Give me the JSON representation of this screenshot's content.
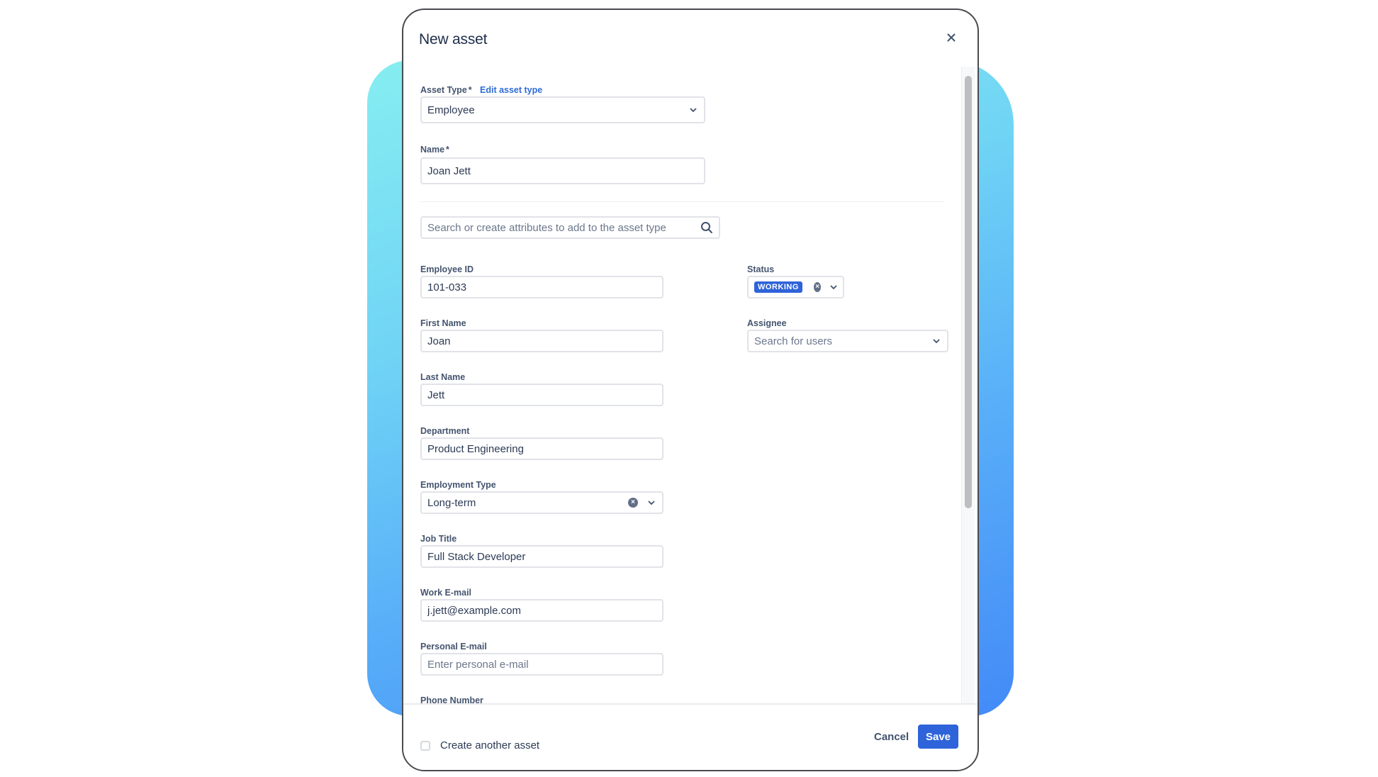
{
  "modal": {
    "title": "New asset",
    "close_icon": "close-icon"
  },
  "asset_type": {
    "label": "Asset Type",
    "required_mark": "*",
    "edit_link": "Edit asset type",
    "value": "Employee"
  },
  "name": {
    "label": "Name",
    "required_mark": "*",
    "value": "Joan Jett"
  },
  "attribute_search": {
    "placeholder": "Search or create attributes to add to the asset type",
    "icon": "search-icon"
  },
  "fields": {
    "employee_id": {
      "label": "Employee ID",
      "value": "101-033"
    },
    "first_name": {
      "label": "First Name",
      "value": "Joan"
    },
    "last_name": {
      "label": "Last Name",
      "value": "Jett"
    },
    "department": {
      "label": "Department",
      "value": "Product Engineering"
    },
    "employment_type": {
      "label": "Employment Type",
      "value": "Long-term"
    },
    "job_title": {
      "label": "Job Title",
      "value": "Full Stack Developer"
    },
    "work_email": {
      "label": "Work E-mail",
      "value": "j.jett@example.com"
    },
    "personal_email": {
      "label": "Personal E-mail",
      "value": "",
      "placeholder": "Enter personal e-mail"
    },
    "phone_number": {
      "label": "Phone Number",
      "value": ""
    },
    "status": {
      "label": "Status",
      "value": "WORKING",
      "badge_color": "#2E63D9"
    },
    "assignee": {
      "label": "Assignee",
      "value": "",
      "placeholder": "Search for users"
    }
  },
  "footer": {
    "create_another_label": "Create another asset",
    "create_another_checked": false,
    "cancel_label": "Cancel",
    "save_label": "Save"
  },
  "colors": {
    "primary": "#2E63D9",
    "link": "#2E6CD8",
    "gradient_start": "#86EEF1",
    "gradient_end": "#438AF7"
  }
}
